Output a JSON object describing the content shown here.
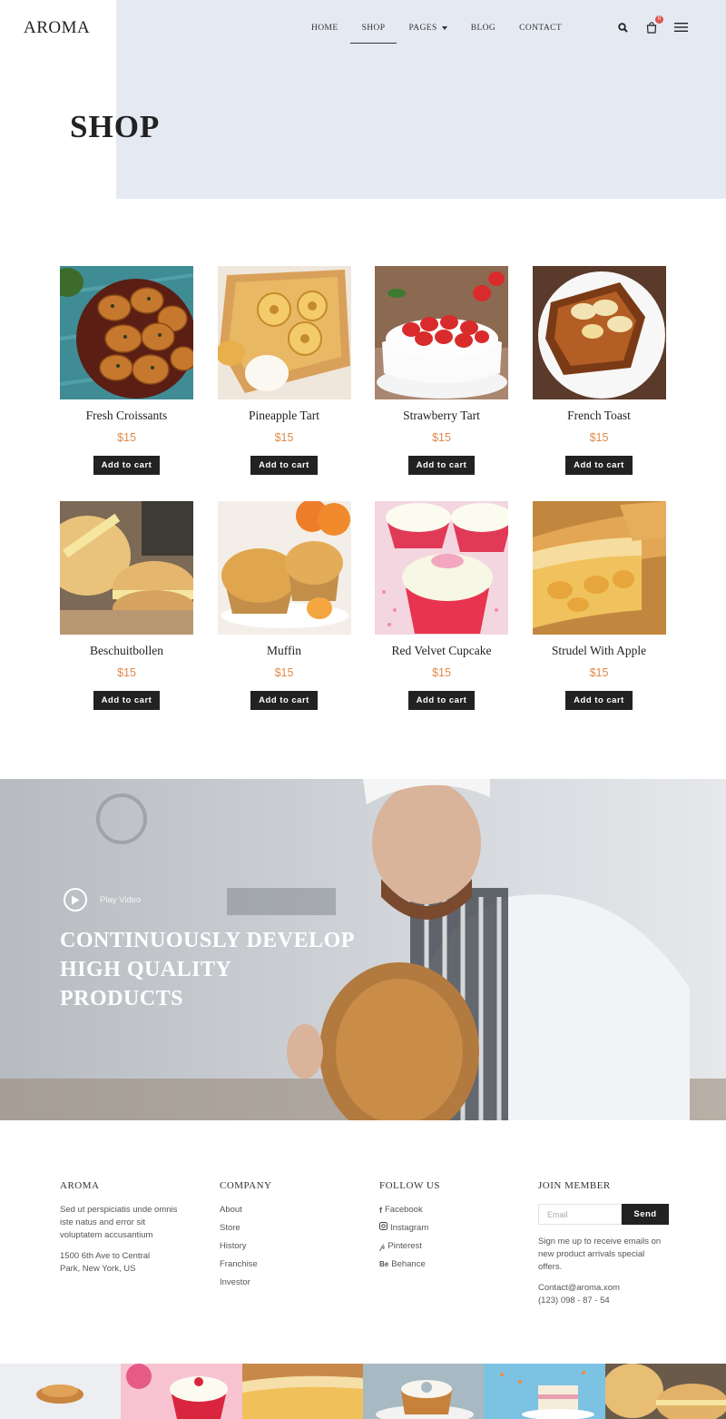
{
  "header": {
    "logo": "AROMA",
    "nav": [
      {
        "label": "HOME"
      },
      {
        "label": "SHOP"
      },
      {
        "label": "PAGES"
      },
      {
        "label": "BLOG"
      },
      {
        "label": "CONTACT"
      }
    ],
    "cart_count": "0",
    "icons": [
      "search-icon",
      "cart-icon",
      "menu-icon"
    ]
  },
  "page": {
    "title": "SHOP"
  },
  "products": [
    {
      "name": "Fresh Croissants",
      "price": "$15",
      "button": "Add to cart"
    },
    {
      "name": "Pineapple Tart",
      "price": "$15",
      "button": "Add to cart"
    },
    {
      "name": "Strawberry Tart",
      "price": "$15",
      "button": "Add to cart"
    },
    {
      "name": "French Toast",
      "price": "$15",
      "button": "Add to cart"
    },
    {
      "name": "Beschuitbollen",
      "price": "$15",
      "button": "Add to cart"
    },
    {
      "name": "Muffin",
      "price": "$15",
      "button": "Add to cart"
    },
    {
      "name": "Red Velvet Cupcake",
      "price": "$15",
      "button": "Add to cart"
    },
    {
      "name": "Strudel With Apple",
      "price": "$15",
      "button": "Add to cart"
    }
  ],
  "banner": {
    "play_label": "Play Video",
    "title": "CONTINUOUSLY DEVELOP HIGH QUALITY PRODUCTS"
  },
  "footer": {
    "about": {
      "heading": "AROMA",
      "text": "Sed ut perspiciatis unde omnis iste natus and error sit voluptatem accusantium",
      "address_line1": "1500 6th Ave to Central",
      "address_line2": "Park, New York, US"
    },
    "company": {
      "heading": "COMPANY",
      "links": [
        "About",
        "Store",
        "History",
        "Franchise",
        "Investor"
      ]
    },
    "follow": {
      "heading": "FOLLOW US",
      "links": [
        {
          "label": "Facebook",
          "icon": "facebook-icon"
        },
        {
          "label": "Instagram",
          "icon": "instagram-icon"
        },
        {
          "label": "Pinterest",
          "icon": "pinterest-icon"
        },
        {
          "label": "Behance",
          "icon": "behance-icon"
        }
      ]
    },
    "join": {
      "heading": "JOIN MEMBER",
      "email_placeholder": "Email",
      "send_label": "Send",
      "text": "Sign me up to receive emails on new product arrivals special offers.",
      "email": "Contact@aroma.xom",
      "phone": "(123) 098 - 87 - 54"
    }
  },
  "colors": {
    "accent_price": "#e08a4a",
    "button_dark": "#222222",
    "hero_bg": "#e4e9f2",
    "badge": "#e0554d"
  }
}
